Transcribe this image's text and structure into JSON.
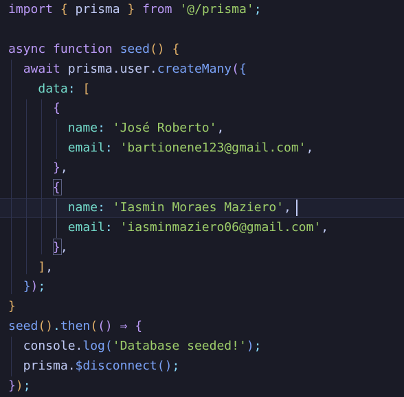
{
  "editor": {
    "lines": [
      [
        {
          "t": "import",
          "c": "#bb9af7"
        },
        {
          "t": " ",
          "c": "#c0caf5"
        },
        {
          "t": "{",
          "c": "#e0af68"
        },
        {
          "t": " prisma ",
          "c": "#c0caf5"
        },
        {
          "t": "}",
          "c": "#e0af68"
        },
        {
          "t": " ",
          "c": "#c0caf5"
        },
        {
          "t": "from",
          "c": "#bb9af7"
        },
        {
          "t": " ",
          "c": "#c0caf5"
        },
        {
          "t": "'@/prisma'",
          "c": "#9ece6a"
        },
        {
          "t": ";",
          "c": "#89ddff"
        }
      ],
      [],
      [
        {
          "t": "async",
          "c": "#bb9af7"
        },
        {
          "t": " ",
          "c": "#c0caf5"
        },
        {
          "t": "function",
          "c": "#bb9af7"
        },
        {
          "t": " ",
          "c": "#c0caf5"
        },
        {
          "t": "seed",
          "c": "#7aa2f7"
        },
        {
          "t": "()",
          "c": "#e0af68"
        },
        {
          "t": " ",
          "c": "#c0caf5"
        },
        {
          "t": "{",
          "c": "#e0af68"
        }
      ],
      [
        {
          "t": "  ",
          "c": "#c0caf5"
        },
        {
          "t": "await",
          "c": "#bb9af7"
        },
        {
          "t": " prisma.user.",
          "c": "#c0caf5"
        },
        {
          "t": "createMany",
          "c": "#7aa2f7"
        },
        {
          "t": "(",
          "c": "#bb9af7"
        },
        {
          "t": "{",
          "c": "#7aa2f7"
        }
      ],
      [
        {
          "t": "    ",
          "c": "#c0caf5"
        },
        {
          "t": "data",
          "c": "#73daca"
        },
        {
          "t": ": ",
          "c": "#89ddff"
        },
        {
          "t": "[",
          "c": "#e0af68"
        }
      ],
      [
        {
          "t": "      ",
          "c": "#c0caf5"
        },
        {
          "t": "{",
          "c": "#bb9af7"
        }
      ],
      [
        {
          "t": "        ",
          "c": "#c0caf5"
        },
        {
          "t": "name",
          "c": "#73daca"
        },
        {
          "t": ": ",
          "c": "#89ddff"
        },
        {
          "t": "'José Roberto'",
          "c": "#9ece6a"
        },
        {
          "t": ",",
          "c": "#c0caf5"
        }
      ],
      [
        {
          "t": "        ",
          "c": "#c0caf5"
        },
        {
          "t": "email",
          "c": "#73daca"
        },
        {
          "t": ": ",
          "c": "#89ddff"
        },
        {
          "t": "'bartionene123@gmail.com'",
          "c": "#9ece6a"
        },
        {
          "t": ",",
          "c": "#c0caf5"
        }
      ],
      [
        {
          "t": "      ",
          "c": "#c0caf5"
        },
        {
          "t": "}",
          "c": "#bb9af7"
        },
        {
          "t": ",",
          "c": "#c0caf5"
        }
      ],
      [
        {
          "t": "      ",
          "c": "#c0caf5"
        },
        {
          "t": "{",
          "c": "#bb9af7"
        }
      ],
      [
        {
          "t": "        ",
          "c": "#c0caf5"
        },
        {
          "t": "name",
          "c": "#73daca"
        },
        {
          "t": ": ",
          "c": "#89ddff"
        },
        {
          "t": "'Iasmin Moraes Maziero'",
          "c": "#9ece6a"
        },
        {
          "t": ",",
          "c": "#c0caf5"
        }
      ],
      [
        {
          "t": "        ",
          "c": "#c0caf5"
        },
        {
          "t": "email",
          "c": "#73daca"
        },
        {
          "t": ": ",
          "c": "#89ddff"
        },
        {
          "t": "'iasminmaziero06@gmail.com'",
          "c": "#9ece6a"
        },
        {
          "t": ",",
          "c": "#c0caf5"
        }
      ],
      [
        {
          "t": "      ",
          "c": "#c0caf5"
        },
        {
          "t": "}",
          "c": "#bb9af7"
        },
        {
          "t": ",",
          "c": "#c0caf5"
        }
      ],
      [
        {
          "t": "    ",
          "c": "#c0caf5"
        },
        {
          "t": "]",
          "c": "#e0af68"
        },
        {
          "t": ",",
          "c": "#c0caf5"
        }
      ],
      [
        {
          "t": "  ",
          "c": "#c0caf5"
        },
        {
          "t": "}",
          "c": "#7aa2f7"
        },
        {
          "t": ")",
          "c": "#bb9af7"
        },
        {
          "t": ";",
          "c": "#89ddff"
        }
      ],
      [
        {
          "t": "}",
          "c": "#e0af68"
        }
      ],
      [
        {
          "t": "seed",
          "c": "#7aa2f7"
        },
        {
          "t": "()",
          "c": "#e0af68"
        },
        {
          "t": ".",
          "c": "#89ddff"
        },
        {
          "t": "then",
          "c": "#7aa2f7"
        },
        {
          "t": "(",
          "c": "#e0af68"
        },
        {
          "t": "()",
          "c": "#bb9af7"
        },
        {
          "t": " ⇒ ",
          "c": "#bb9af7"
        },
        {
          "t": "{",
          "c": "#bb9af7"
        }
      ],
      [
        {
          "t": "  console.",
          "c": "#c0caf5"
        },
        {
          "t": "log",
          "c": "#7aa2f7"
        },
        {
          "t": "(",
          "c": "#7aa2f7"
        },
        {
          "t": "'Database seeded!'",
          "c": "#9ece6a"
        },
        {
          "t": ")",
          "c": "#7aa2f7"
        },
        {
          "t": ";",
          "c": "#89ddff"
        }
      ],
      [
        {
          "t": "  prisma.",
          "c": "#c0caf5"
        },
        {
          "t": "$disconnect",
          "c": "#7aa2f7"
        },
        {
          "t": "()",
          "c": "#7aa2f7"
        },
        {
          "t": ";",
          "c": "#89ddff"
        }
      ],
      [
        {
          "t": "}",
          "c": "#bb9af7"
        },
        {
          "t": ")",
          "c": "#e0af68"
        },
        {
          "t": ";",
          "c": "#89ddff"
        }
      ]
    ]
  },
  "colors": {
    "background": "#1a1b26",
    "keyword": "#bb9af7",
    "function": "#7aa2f7",
    "string": "#9ece6a",
    "property": "#73daca",
    "bracket": "#e0af68"
  }
}
